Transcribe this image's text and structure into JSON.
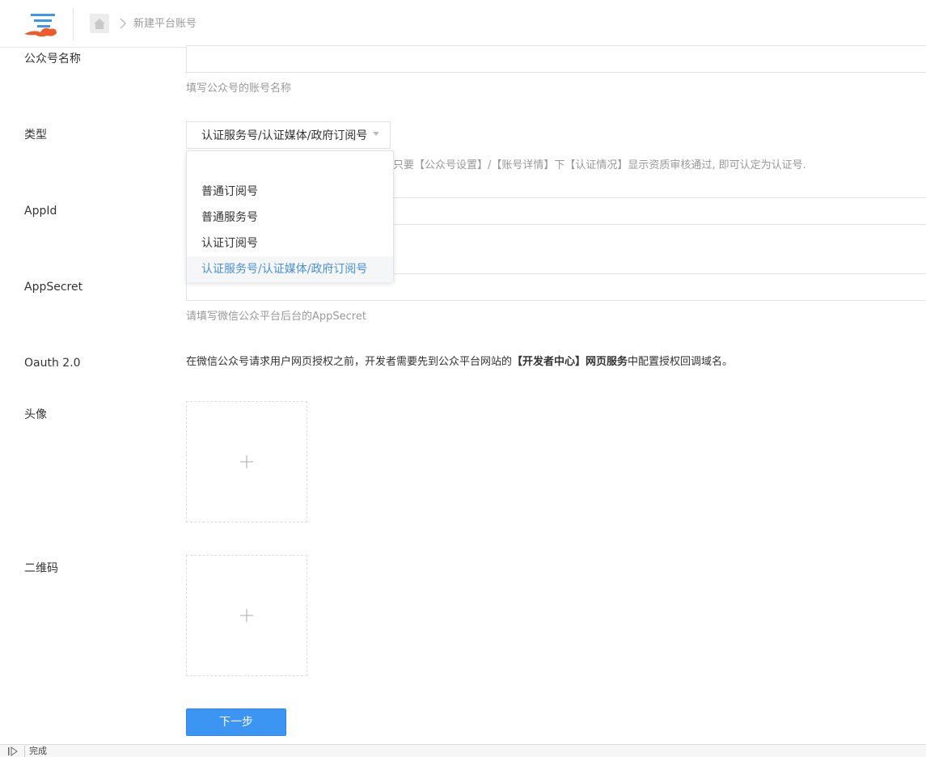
{
  "header": {
    "breadcrumb_current": "新建平台账号",
    "icons": {
      "logo": "brand-logo-icon",
      "home": "home-icon",
      "separator": "chevron-right-icon"
    }
  },
  "form": {
    "name": {
      "label": "公众号名称",
      "value": "",
      "help": "填写公众号的账号名称"
    },
    "type": {
      "label": "类型",
      "selected": "认证服务号/认证媒体/政府订阅号",
      "help_visible_part": "只要【公众号设置】/【账号详情】下【认证情况】显示资质审核通过, 即可认定为认证号.",
      "options": [
        {
          "label": ""
        },
        {
          "label": "普通订阅号"
        },
        {
          "label": "普通服务号"
        },
        {
          "label": "认证订阅号"
        },
        {
          "label": "认证服务号/认证媒体/政府订阅号",
          "selected": true
        }
      ]
    },
    "appid": {
      "label": "AppId",
      "value": ""
    },
    "appsecret": {
      "label": "AppSecret",
      "value": "",
      "help": "请填写微信公众平台后台的AppSecret"
    },
    "oauth": {
      "label": "Oauth 2.0",
      "text_before": "在微信公众号请求用户网页授权之前，开发者需要先到公众平台网站的",
      "text_bold": "【开发者中心】网页服务",
      "text_after": "中配置授权回调域名。"
    },
    "avatar": {
      "label": "头像"
    },
    "qrcode": {
      "label": "二维码"
    },
    "next_button": "下一步"
  },
  "statusbar": {
    "text": "完成"
  },
  "colors": {
    "primary": "#3d95f3",
    "selected_option": "#4a90d9",
    "help_text": "#999999",
    "border": "#e2e2e2"
  }
}
